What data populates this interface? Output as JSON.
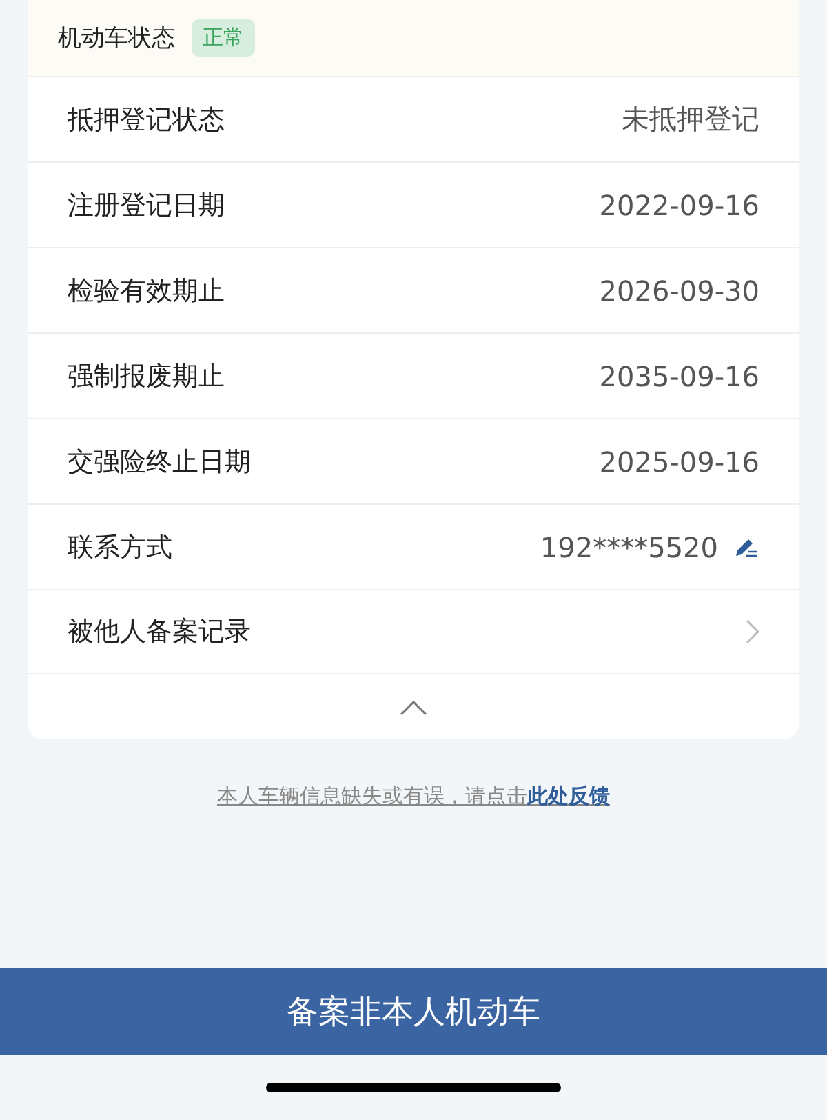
{
  "status": {
    "label": "机动车状态",
    "badge": "正常"
  },
  "rows": [
    {
      "kind": "text",
      "label": "抵押登记状态",
      "value": "未抵押登记"
    },
    {
      "kind": "text",
      "label": "注册登记日期",
      "value": "2022-09-16"
    },
    {
      "kind": "text",
      "label": "检验有效期止",
      "value": "2026-09-30"
    },
    {
      "kind": "text",
      "label": "强制报废期止",
      "value": "2035-09-16"
    },
    {
      "kind": "text",
      "label": "交强险终止日期",
      "value": "2025-09-16"
    },
    {
      "kind": "editable",
      "label": "联系方式",
      "value": "192****5520"
    },
    {
      "kind": "link",
      "label": "被他人备案记录"
    }
  ],
  "collapse": {
    "expanded": true
  },
  "feedback": {
    "text": "本人车辆信息缺失或有误，请点击",
    "link": "此处反馈"
  },
  "action_button": "备案非本人机动车"
}
